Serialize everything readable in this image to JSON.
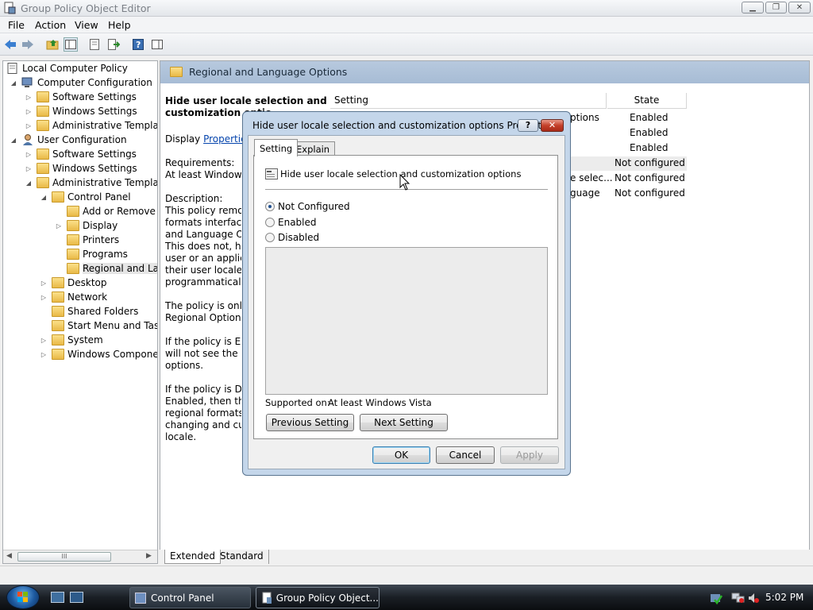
{
  "window": {
    "title": "Group Policy Object Editor",
    "caption_buttons": [
      "minimize-icon",
      "maximize-icon",
      "close-icon"
    ]
  },
  "menu": [
    "File",
    "Action",
    "View",
    "Help"
  ],
  "tree": {
    "root": "Local Computer Policy",
    "items": [
      {
        "label": "Computer Configuration"
      },
      {
        "label": "Software Settings"
      },
      {
        "label": "Windows Settings"
      },
      {
        "label": "Administrative Template"
      },
      {
        "label": "User Configuration"
      },
      {
        "label": "Software Settings"
      },
      {
        "label": "Windows Settings"
      },
      {
        "label": "Administrative Template"
      },
      {
        "label": "Control Panel"
      },
      {
        "label": "Add or Remove P"
      },
      {
        "label": "Display"
      },
      {
        "label": "Printers"
      },
      {
        "label": "Programs"
      },
      {
        "label": "Regional and Lan"
      },
      {
        "label": "Desktop"
      },
      {
        "label": "Network"
      },
      {
        "label": "Shared Folders"
      },
      {
        "label": "Start Menu and Task"
      },
      {
        "label": "System"
      },
      {
        "label": "Windows Componen"
      }
    ],
    "scroll_glyph": "III"
  },
  "main": {
    "header": "Regional and Language Options",
    "columns": {
      "setting": "Setting",
      "state": "State"
    },
    "description": {
      "title_l1": "Hide user locale selection and",
      "title_l2": "customization optio",
      "display_prefix": "Display",
      "display_link": "Properties",
      "lines": [
        "Requirements:",
        "At least Windows V",
        "",
        "Description:",
        "This policy remove",
        "formats interface f",
        "and Language Opt",
        "This does not, how",
        "user or an applicat",
        "their user locale or",
        "programmatically.",
        "",
        "The policy is only",
        "Regional Options c",
        "",
        "If the policy is Ena",
        "will not see the reg",
        "options.",
        "",
        "If the policy is Disa",
        "Enabled, then the u",
        "regional formats o",
        "changing and cust",
        "locale."
      ]
    },
    "rows": [
      {
        "setting": "ptions",
        "state": "Enabled"
      },
      {
        "setting": "",
        "state": "Enabled"
      },
      {
        "setting": "",
        "state": "Enabled"
      },
      {
        "setting": "",
        "state": "Not configured"
      },
      {
        "setting": "e selec...",
        "state": "Not configured"
      },
      {
        "setting": "guage",
        "state": "Not configured"
      }
    ],
    "bottom_tabs": [
      "Extended",
      "Standard"
    ]
  },
  "dialog": {
    "title": "Hide user locale selection and customization options Propert...",
    "tabs": [
      "Setting",
      "Explain"
    ],
    "policy_name": "Hide user locale selection and customization options",
    "options": [
      "Not Configured",
      "Enabled",
      "Disabled"
    ],
    "selected_option": 0,
    "supported_label": "Supported on:",
    "supported_value": "At least Windows Vista",
    "prev_button": "Previous Setting",
    "next_button": "Next Setting",
    "ok": "OK",
    "cancel": "Cancel",
    "apply": "Apply"
  },
  "taskbar": {
    "buttons": [
      {
        "label": "Control Panel"
      },
      {
        "label": "Group Policy Object..."
      }
    ],
    "clock": "5:02 PM"
  }
}
